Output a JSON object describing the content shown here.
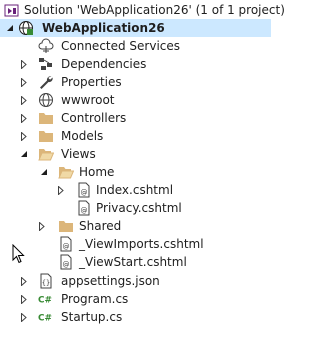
{
  "solution": {
    "label": "Solution 'WebApplication26' (1 of 1 project)",
    "icon": "solution-icon"
  },
  "project": {
    "label": "WebApplication26",
    "icon": "web-project-icon",
    "state": "expanded"
  },
  "items": [
    {
      "label": "Connected Services",
      "icon": "connected-services-icon"
    },
    {
      "label": "Dependencies",
      "icon": "dependencies-icon",
      "state": "collapsed"
    },
    {
      "label": "Properties",
      "icon": "wrench-icon",
      "state": "collapsed"
    },
    {
      "label": "wwwroot",
      "icon": "globe-icon",
      "state": "collapsed"
    },
    {
      "label": "Controllers",
      "icon": "folder-icon",
      "state": "collapsed"
    },
    {
      "label": "Models",
      "icon": "folder-icon",
      "state": "collapsed"
    },
    {
      "label": "Views",
      "icon": "folder-open-icon",
      "state": "expanded"
    },
    {
      "label": "Home",
      "icon": "folder-open-icon",
      "state": "expanded"
    },
    {
      "label": "Index.cshtml",
      "icon": "razor-file-icon",
      "state": "collapsed"
    },
    {
      "label": "Privacy.cshtml",
      "icon": "razor-file-icon"
    },
    {
      "label": "Shared",
      "icon": "folder-icon",
      "state": "collapsed"
    },
    {
      "label": "_ViewImports.cshtml",
      "icon": "razor-file-icon"
    },
    {
      "label": "_ViewStart.cshtml",
      "icon": "razor-file-icon"
    },
    {
      "label": "appsettings.json",
      "icon": "json-file-icon",
      "state": "collapsed"
    },
    {
      "label": "Program.cs",
      "icon": "csharp-file-icon",
      "state": "collapsed"
    },
    {
      "label": "Startup.cs",
      "icon": "csharp-file-icon",
      "state": "collapsed"
    }
  ],
  "colors": {
    "selection": "#cce8ff",
    "folder": "#dcb67a",
    "csharp": "#388a34",
    "arrow": "#1e1e1e"
  }
}
